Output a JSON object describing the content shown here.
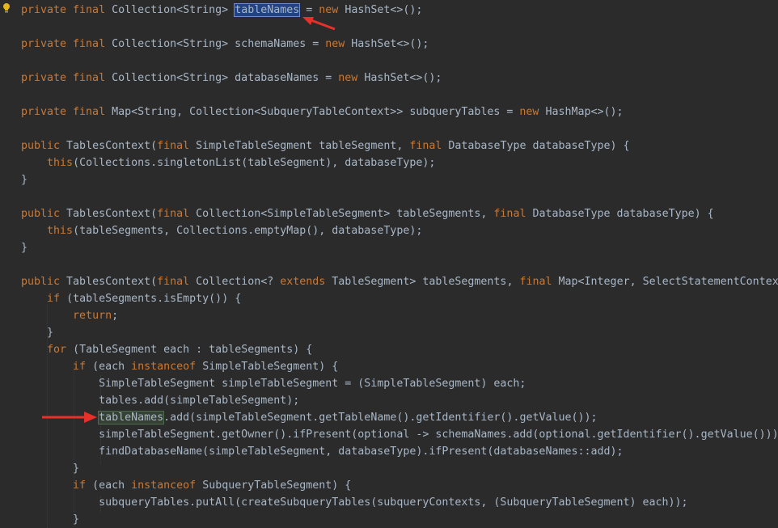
{
  "editor": {
    "lines": [
      [
        [
          "kw",
          "private final "
        ],
        [
          "t",
          "Collection<String> "
        ],
        [
          "sel",
          "tableNames"
        ],
        [
          "t",
          " = "
        ],
        [
          "kw",
          "new "
        ],
        [
          "t",
          "HashSet<>();"
        ]
      ],
      [],
      [
        [
          "kw",
          "private final "
        ],
        [
          "t",
          "Collection<String> schemaNames = "
        ],
        [
          "kw",
          "new "
        ],
        [
          "t",
          "HashSet<>();"
        ]
      ],
      [],
      [
        [
          "kw",
          "private final "
        ],
        [
          "t",
          "Collection<String> databaseNames = "
        ],
        [
          "kw",
          "new "
        ],
        [
          "t",
          "HashSet<>();"
        ]
      ],
      [],
      [
        [
          "kw",
          "private final "
        ],
        [
          "t",
          "Map<String, Collection<SubqueryTableContext>> subqueryTables = "
        ],
        [
          "kw",
          "new "
        ],
        [
          "t",
          "HashMap<>();"
        ]
      ],
      [],
      [
        [
          "kw",
          "public "
        ],
        [
          "t",
          "TablesContext("
        ],
        [
          "kw",
          "final "
        ],
        [
          "t",
          "SimpleTableSegment tableSegment, "
        ],
        [
          "kw",
          "final "
        ],
        [
          "t",
          "DatabaseType databaseType) {"
        ]
      ],
      [
        [
          "t",
          "    "
        ],
        [
          "kw",
          "this"
        ],
        [
          "t",
          "(Collections.singletonList(tableSegment), databaseType);"
        ]
      ],
      [
        [
          "t",
          "}"
        ]
      ],
      [],
      [
        [
          "kw",
          "public "
        ],
        [
          "t",
          "TablesContext("
        ],
        [
          "kw",
          "final "
        ],
        [
          "t",
          "Collection<SimpleTableSegment> tableSegments, "
        ],
        [
          "kw",
          "final "
        ],
        [
          "t",
          "DatabaseType databaseType) {"
        ]
      ],
      [
        [
          "t",
          "    "
        ],
        [
          "kw",
          "this"
        ],
        [
          "t",
          "(tableSegments, Collections.emptyMap(), databaseType);"
        ]
      ],
      [
        [
          "t",
          "}"
        ]
      ],
      [],
      [
        [
          "kw",
          "public "
        ],
        [
          "t",
          "TablesContext("
        ],
        [
          "kw",
          "final "
        ],
        [
          "t",
          "Collection<? "
        ],
        [
          "kw",
          "extends "
        ],
        [
          "t",
          "TableSegment> tableSegments, "
        ],
        [
          "kw",
          "final "
        ],
        [
          "t",
          "Map<Integer, SelectStatementContex"
        ]
      ],
      [
        [
          "t",
          "    "
        ],
        [
          "kw",
          "if "
        ],
        [
          "t",
          "(tableSegments.isEmpty()) {"
        ]
      ],
      [
        [
          "t",
          "        "
        ],
        [
          "kw",
          "return"
        ],
        [
          "t",
          ";"
        ]
      ],
      [
        [
          "t",
          "    }"
        ]
      ],
      [
        [
          "t",
          "    "
        ],
        [
          "kw",
          "for "
        ],
        [
          "t",
          "(TableSegment each : tableSegments) {"
        ]
      ],
      [
        [
          "t",
          "        "
        ],
        [
          "kw",
          "if "
        ],
        [
          "t",
          "(each "
        ],
        [
          "kw",
          "instanceof "
        ],
        [
          "t",
          "SimpleTableSegment) {"
        ]
      ],
      [
        [
          "t",
          "            SimpleTableSegment simpleTableSegment = (SimpleTableSegment) each;"
        ]
      ],
      [
        [
          "t",
          "            tables.add(simpleTableSegment);"
        ]
      ],
      [
        [
          "t",
          "            "
        ],
        [
          "wr",
          "tableNames"
        ],
        [
          "t",
          ".add(simpleTableSegment.getTableName().getIdentifier().getValue());"
        ]
      ],
      [
        [
          "t",
          "            simpleTableSegment.getOwner().ifPresent(optional -> schemaNames.add(optional.getIdentifier().getValue()));"
        ]
      ],
      [
        [
          "t",
          "            findDatabaseName(simpleTableSegment, databaseType).ifPresent(databaseNames::add);"
        ]
      ],
      [
        [
          "t",
          "        }"
        ]
      ],
      [
        [
          "t",
          "        "
        ],
        [
          "kw",
          "if "
        ],
        [
          "t",
          "(each "
        ],
        [
          "kw",
          "instanceof "
        ],
        [
          "t",
          "SubqueryTableSegment) {"
        ]
      ],
      [
        [
          "t",
          "            subqueryTables.putAll(createSubqueryTables(subqueryContexts, (SubqueryTableSegment) each));"
        ]
      ],
      [
        [
          "t",
          "        }"
        ]
      ]
    ],
    "colors": {
      "background": "#2b2b2b",
      "text": "#a9b7c6",
      "keyword": "#cc7832",
      "selection": "#214283",
      "write_highlight": "#344134",
      "arrow": "#e8302a",
      "bulb": "#e6b422"
    },
    "icons": [
      "intention-bulb-icon",
      "red-arrow-annotation",
      "red-arrow-annotation"
    ]
  }
}
